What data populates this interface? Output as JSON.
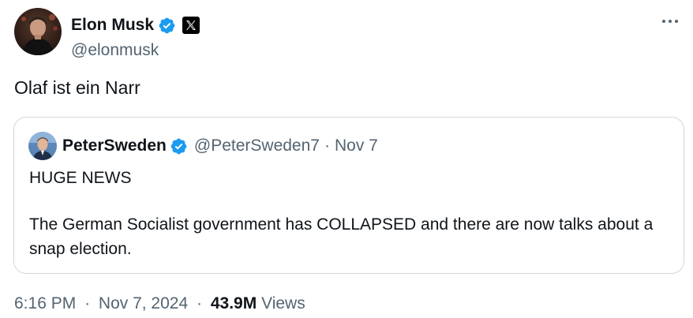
{
  "author": {
    "display_name": "Elon Musk",
    "handle": "@elonmusk",
    "verified_color": "#1d9bf0",
    "affiliation_icon": "x-logo-icon"
  },
  "tweet": {
    "text": "Olaf ist ein Narr"
  },
  "quoted": {
    "display_name": "PeterSweden",
    "handle": "@PeterSweden7",
    "separator": "·",
    "date": "Nov 7",
    "paragraphs": [
      "HUGE NEWS",
      "The German Socialist government has COLLAPSED and there are now talks about a snap election."
    ]
  },
  "meta": {
    "time": "6:16 PM",
    "separator": "·",
    "date": "Nov 7, 2024",
    "views_count": "43.9M",
    "views_label": "Views"
  },
  "menu": {
    "more_icon": "more-options-icon"
  }
}
